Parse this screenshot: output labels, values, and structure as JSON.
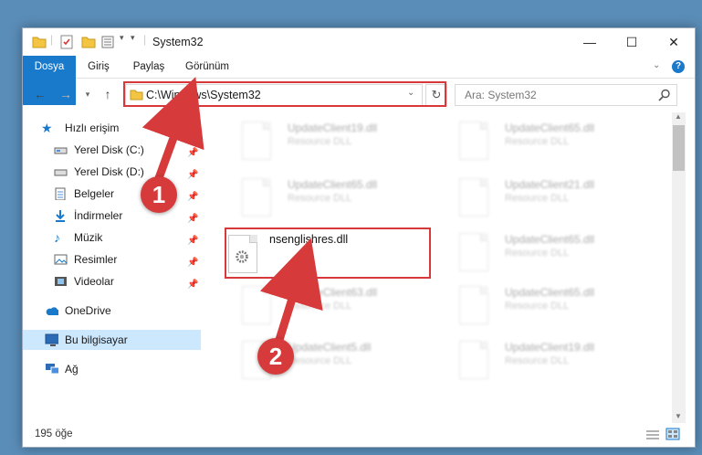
{
  "window": {
    "title": "System32"
  },
  "controls": {
    "minimize": "—",
    "maximize": "☐",
    "close": "✕"
  },
  "ribbon": {
    "tabs": [
      "Dosya",
      "Giriş",
      "Paylaş",
      "Görünüm"
    ]
  },
  "address": {
    "path": "C:\\Windows\\System32"
  },
  "search": {
    "placeholder": "Ara: System32"
  },
  "nav": {
    "quick_access": "Hızlı erişim",
    "items": [
      "Yerel Disk (C:)",
      "Yerel Disk (D:)",
      "Belgeler",
      "İndirmeler",
      "Müzik",
      "Resimler",
      "Videolar"
    ],
    "onedrive": "OneDrive",
    "this_pc": "Bu bilgisayar",
    "network": "Ağ"
  },
  "files": {
    "blurred_left": [
      {
        "name": "UpdateClient19.dll",
        "type": "Resource DLL"
      },
      {
        "name": "UpdateClient65.dll",
        "type": "Resource DLL"
      },
      {
        "name": "UpdateClient63.dll",
        "type": "Resource DLL"
      },
      {
        "name": "UpdateClient5.dll",
        "type": "Resource DLL"
      }
    ],
    "blurred_right": [
      {
        "name": "UpdateClient65.dll",
        "type": "Resource DLL"
      },
      {
        "name": "UpdateClient21.dll",
        "type": "Resource DLL"
      },
      {
        "name": "UpdateClient65.dll",
        "type": "Resource DLL"
      },
      {
        "name": "UpdateClient65.dll",
        "type": "Resource DLL"
      },
      {
        "name": "UpdateClient19.dll",
        "type": "Resource DLL"
      }
    ],
    "highlighted": {
      "name": "nsenglishres.dll"
    }
  },
  "status": {
    "count": "195 öğe"
  },
  "callouts": {
    "one": "1",
    "two": "2"
  },
  "colors": {
    "accent": "#1979ca",
    "highlight": "#d9383a",
    "selected": "#cce8ff"
  }
}
